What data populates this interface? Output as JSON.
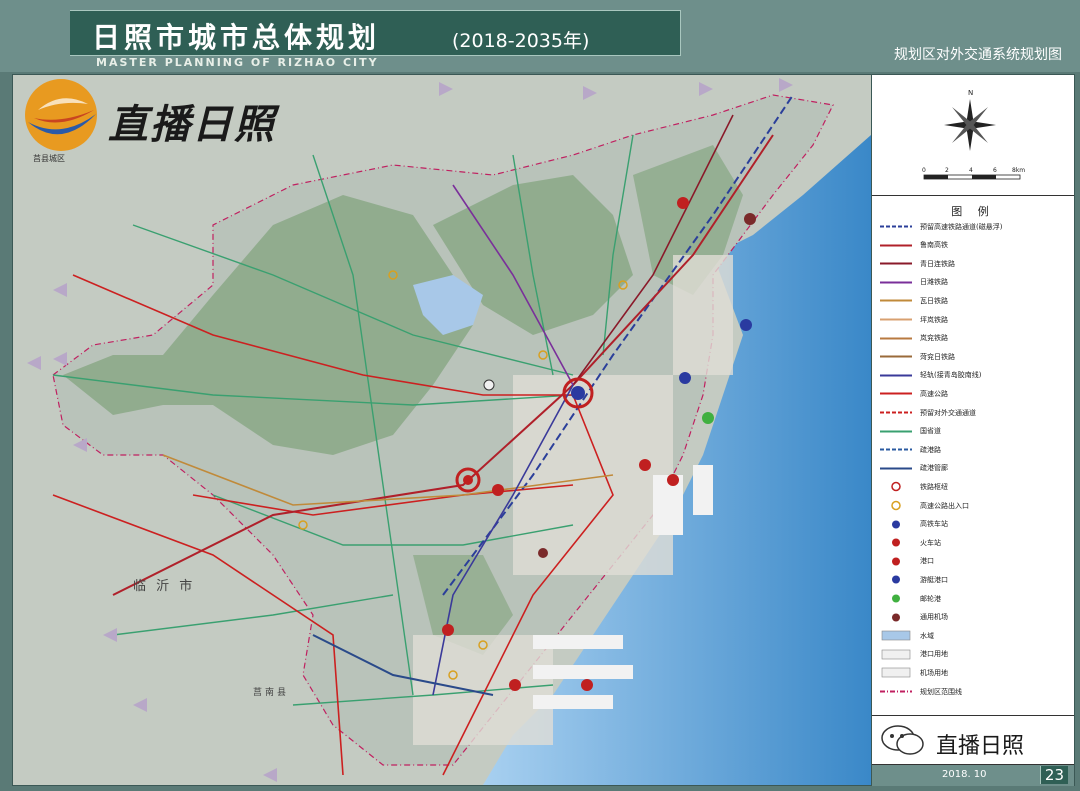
{
  "header": {
    "title": "日照市城市总体规划",
    "years": "(2018-2035年)",
    "subtitle_en": "MASTER PLANNING OF RIZHAO CITY",
    "map_title": "规划区对外交通系统规划图"
  },
  "watermark": {
    "text": "直播日照"
  },
  "compass": {
    "north_label": "N",
    "scale_labels": [
      "0",
      "2",
      "4",
      "6",
      "8km"
    ]
  },
  "legend": {
    "title": "图 例",
    "items": [
      {
        "label": "预留高速铁路通道(磁悬浮)",
        "style": "dash",
        "color": "#2b3f9a"
      },
      {
        "label": "鲁南高铁",
        "style": "line",
        "color": "#b0202a"
      },
      {
        "label": "青日连铁路",
        "style": "line",
        "color": "#8a1a2a"
      },
      {
        "label": "日潍铁路",
        "style": "line",
        "color": "#7a2f9a"
      },
      {
        "label": "瓦日铁路",
        "style": "line",
        "color": "#c08a3a"
      },
      {
        "label": "坪岚铁路",
        "style": "line",
        "color": "#d8a070"
      },
      {
        "label": "岚兖铁路",
        "style": "line",
        "color": "#b87a40"
      },
      {
        "label": "菏兖日铁路",
        "style": "line",
        "color": "#9a6a3a"
      },
      {
        "label": "轻轨(接青岛胶南线)",
        "style": "line",
        "color": "#3a3a9a"
      },
      {
        "label": "高速公路",
        "style": "line",
        "color": "#cc2020"
      },
      {
        "label": "预留对外交通通道",
        "style": "dash",
        "color": "#cc2020"
      },
      {
        "label": "国省道",
        "style": "line",
        "color": "#3aa070"
      },
      {
        "label": "疏港路",
        "style": "dash",
        "color": "#2a5aa0"
      },
      {
        "label": "疏港管廊",
        "style": "line",
        "color": "#2a4a8a"
      },
      {
        "label": "铁路枢纽",
        "style": "circle",
        "color": "#c02020"
      },
      {
        "label": "高速公路出入口",
        "style": "circle",
        "color": "#d8a020"
      },
      {
        "label": "高铁车站",
        "style": "dot",
        "color": "#2a3aa0"
      },
      {
        "label": "火车站",
        "style": "dot",
        "color": "#c02020"
      },
      {
        "label": "港口",
        "style": "dot",
        "color": "#c02020"
      },
      {
        "label": "游艇港口",
        "style": "dot",
        "color": "#2a3aa0"
      },
      {
        "label": "邮轮港",
        "style": "dot",
        "color": "#40b040"
      },
      {
        "label": "通用机场",
        "style": "dot",
        "color": "#7a2a2a"
      },
      {
        "label": "水域",
        "style": "fill",
        "color": "#a8c8e8"
      },
      {
        "label": "港口用地",
        "style": "fill-anchor",
        "color": "#f0f0f0"
      },
      {
        "label": "机场用地",
        "style": "fill-plane",
        "color": "#f0f0f0"
      },
      {
        "label": "规划区范围线",
        "style": "dashdot",
        "color": "#c02060"
      }
    ]
  },
  "footer": {
    "brand": "直播日照",
    "date": "2018. 10",
    "page": "23"
  },
  "map_labels": {
    "linyi": "临 沂 市",
    "junan": "莒南县",
    "juxian": "莒县城区"
  },
  "colors": {
    "banner": "#2f5f55",
    "frame": "#6e8f8b",
    "land": "#c9d1c9",
    "sea": "#6aa8d8",
    "mountain": "#7a9a78"
  }
}
